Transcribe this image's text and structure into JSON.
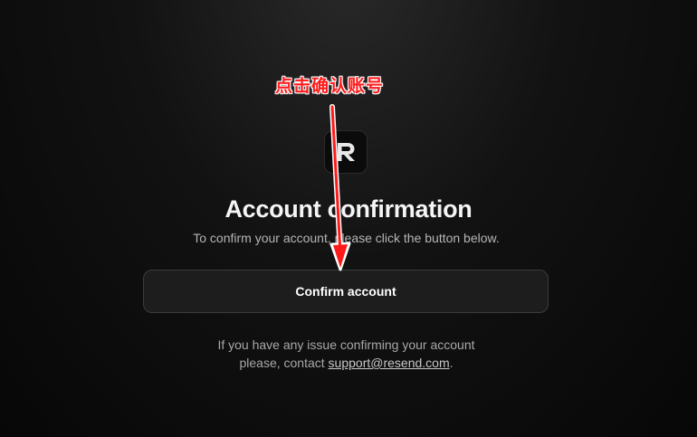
{
  "annotation": {
    "label": "点击确认账号",
    "color": "#ff1a1a"
  },
  "logo": {
    "icon": "resend-r-logo"
  },
  "page": {
    "title": "Account confirmation",
    "subtitle": "To confirm your account, please click the button below."
  },
  "button": {
    "label": "Confirm account"
  },
  "footer": {
    "line1": "If you have any issue confirming your account",
    "line2_prefix": "please, contact ",
    "email": "support@resend.com",
    "line2_suffix": "."
  }
}
